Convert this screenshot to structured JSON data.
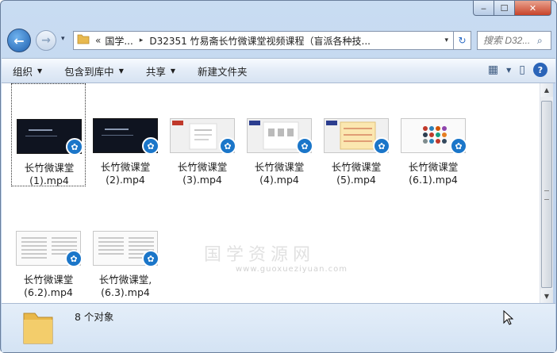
{
  "window": {
    "min_glyph": "‒",
    "max_glyph": "☐",
    "close_glyph": "✕"
  },
  "nav": {
    "back_glyph": "←",
    "forward_glyph": "→",
    "dropdown_glyph": "▾",
    "address_prefix": "«",
    "breadcrumbs": [
      "国学...",
      "D32351 竹易斋长竹微课堂视频课程（盲派各种技..."
    ],
    "breadcrumb_sep": "▸",
    "address_dropdown": "▾",
    "refresh_glyph": "↻",
    "search_placeholder": "搜索 D32...",
    "search_glyph": "⌕"
  },
  "toolbar": {
    "items": [
      {
        "label": "组织",
        "has_arrow": true
      },
      {
        "label": "包含到库中",
        "has_arrow": true
      },
      {
        "label": "共享",
        "has_arrow": true
      },
      {
        "label": "新建文件夹",
        "has_arrow": false
      }
    ],
    "arrow_glyph": "▼",
    "view_glyph": "▦",
    "view_arrow": "▼",
    "pane_glyph": "▯",
    "help_glyph": "?"
  },
  "files": [
    {
      "name_line1": "长竹微课堂",
      "name_line2": "(1).mp4",
      "thumb": "dark",
      "selected": true
    },
    {
      "name_line1": "长竹微课堂",
      "name_line2": "(2).mp4",
      "thumb": "dark",
      "selected": false
    },
    {
      "name_line1": "长竹微课堂",
      "name_line2": "(3).mp4",
      "thumb": "slides",
      "selected": false
    },
    {
      "name_line1": "长竹微课堂",
      "name_line2": "(4).mp4",
      "thumb": "slides",
      "selected": false
    },
    {
      "name_line1": "长竹微课堂",
      "name_line2": "(5).mp4",
      "thumb": "slides",
      "selected": false
    },
    {
      "name_line1": "长竹微课堂",
      "name_line2": "(6.1).mp4",
      "thumb": "paper",
      "selected": false
    },
    {
      "name_line1": "长竹微课堂",
      "name_line2": "(6.2).mp4",
      "thumb": "paper",
      "selected": false
    },
    {
      "name_line1": "长竹微课堂,",
      "name_line2": "(6.3).mp4",
      "thumb": "paper",
      "selected": false
    }
  ],
  "video_badge_glyph": "✿",
  "scrollbar": {
    "up_glyph": "▲",
    "down_glyph": "▼"
  },
  "status": {
    "count_text": "8 个对象"
  },
  "watermark": {
    "text": "国学资源网",
    "url": "www.guoxueziyuan.com"
  },
  "colors": {
    "accent": "#1b76c9",
    "close": "#c8432a"
  }
}
